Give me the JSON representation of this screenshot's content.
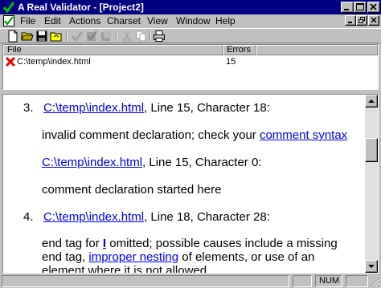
{
  "window": {
    "title": "A Real Validator - [Project2]",
    "accent": "#000080"
  },
  "menu": {
    "items": [
      {
        "label": "File",
        "name": "menu-file"
      },
      {
        "label": "Edit",
        "name": "menu-edit"
      },
      {
        "label": "Actions",
        "name": "menu-actions"
      },
      {
        "label": "Charset",
        "name": "menu-charset"
      },
      {
        "label": "View",
        "name": "menu-view"
      },
      {
        "label": "Window",
        "name": "menu-window"
      },
      {
        "label": "Help",
        "name": "menu-help"
      }
    ]
  },
  "toolbar": {
    "buttons": [
      "new-icon",
      "open-icon",
      "save-icon",
      "open-folder-icon",
      "validate-check-icon",
      "validate-all-icon",
      "stop-icon",
      "cut-icon",
      "copy-icon",
      "print-icon"
    ]
  },
  "results": {
    "columns": [
      "File",
      "Errors"
    ],
    "rows": [
      {
        "file": "C:\\temp\\index.html",
        "errors": "15",
        "status_icon": "error-x-icon"
      }
    ]
  },
  "details": {
    "item3": {
      "num": "3.",
      "link1": "C:\\temp\\index.html",
      "loc1": ", Line 15, Character 18:",
      "msg1": "invalid comment declaration; check your ",
      "msg1_link": "comment syntax",
      "link2": "C:\\temp\\index.html",
      "loc2": ", Line 15, Character 0:",
      "msg2": "comment declaration started here"
    },
    "item4": {
      "num": "4.",
      "link1": "C:\\temp\\index.html",
      "loc1": ", Line 18, Character 28:",
      "msg_a": "end tag for ",
      "tag": "I",
      "msg_b": " omitted; possible causes include a missing",
      "msg_c": "end tag, ",
      "msg_link": "improper nesting",
      "msg_d": " of elements, or use of an",
      "msg_e": "element where it is not allowed"
    }
  },
  "status": {
    "num": "NUM"
  }
}
